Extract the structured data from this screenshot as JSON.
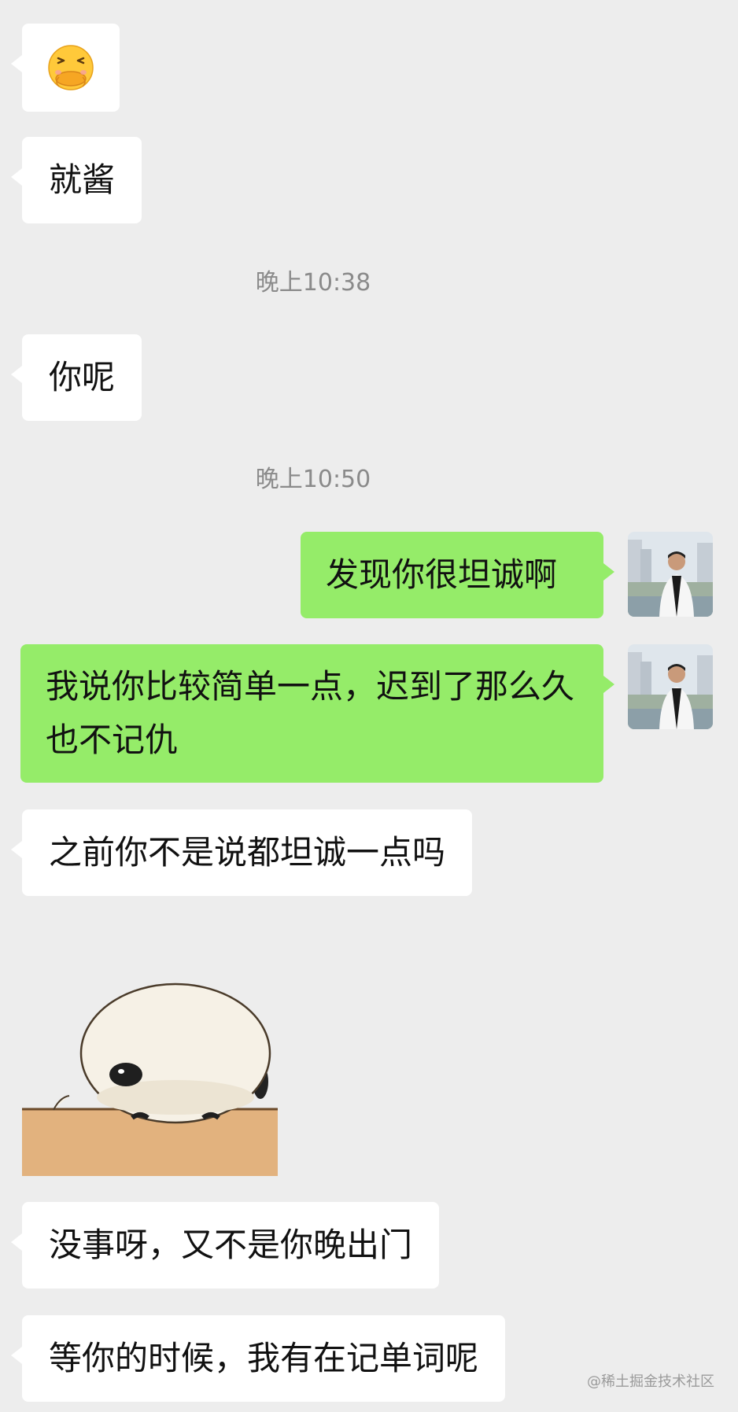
{
  "messages": [
    {
      "type": "emoji",
      "side": "left",
      "emoji": "confounded-hand-over-mouth-emoji"
    },
    {
      "type": "text",
      "side": "left",
      "text": "就酱"
    },
    {
      "type": "time",
      "text": "晚上10:38"
    },
    {
      "type": "text",
      "side": "left",
      "text": "你呢"
    },
    {
      "type": "time",
      "text": "晚上10:50"
    },
    {
      "type": "text",
      "side": "right",
      "text": "发现你很坦诚啊"
    },
    {
      "type": "text",
      "side": "right",
      "text": "我说你比较简单一点，迟到了那么久也不记仇"
    },
    {
      "type": "text",
      "side": "left",
      "text": "之前你不是说都坦诚一点吗"
    },
    {
      "type": "sticker",
      "side": "left",
      "sticker": "panda-lying-on-table-sticker"
    },
    {
      "type": "text",
      "side": "left",
      "text": "没事呀，又不是你晚出门"
    },
    {
      "type": "text",
      "side": "left",
      "text": "等你的时候，我有在记单词呢"
    }
  ],
  "watermark": "@稀土掘金技术社区",
  "colors": {
    "background": "#ededed",
    "incoming_bubble": "#ffffff",
    "outgoing_bubble": "#95ec69",
    "timestamp": "#8a8a8a"
  }
}
